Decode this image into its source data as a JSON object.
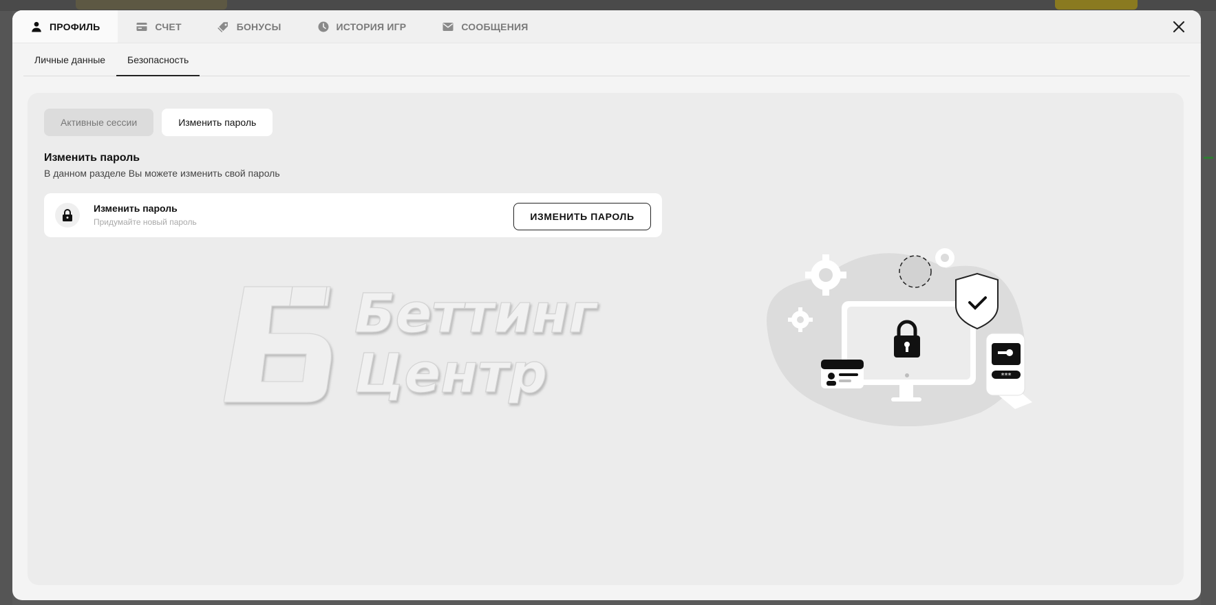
{
  "top_tabs": [
    {
      "label": "ПРОФИЛЬ",
      "icon": "user-icon",
      "active": true
    },
    {
      "label": "СЧЕТ",
      "icon": "card-icon",
      "active": false
    },
    {
      "label": "БОНУСЫ",
      "icon": "tag-icon",
      "active": false
    },
    {
      "label": "ИСТОРИЯ ИГР",
      "icon": "clock-icon",
      "active": false
    },
    {
      "label": "СООБЩЕНИЯ",
      "icon": "mail-icon",
      "active": false
    }
  ],
  "sub_tabs": [
    {
      "label": "Личные данные",
      "active": false
    },
    {
      "label": "Безопасность",
      "active": true
    }
  ],
  "pills": {
    "sessions": "Активные сессии",
    "change_password": "Изменить пароль"
  },
  "section": {
    "title": "Изменить пароль",
    "description": "В данном разделе Вы можете изменить свой пароль"
  },
  "card": {
    "title": "Изменить пароль",
    "subtitle": "Придумайте новый пароль",
    "button": "ИЗМЕНИТЬ ПАРОЛЬ"
  },
  "watermark": {
    "line1": "Беттинг",
    "line2": "Центр"
  },
  "colors": {
    "modal_bg": "#f4f4f4",
    "panel_bg": "#ececec",
    "accent": "#111111"
  }
}
